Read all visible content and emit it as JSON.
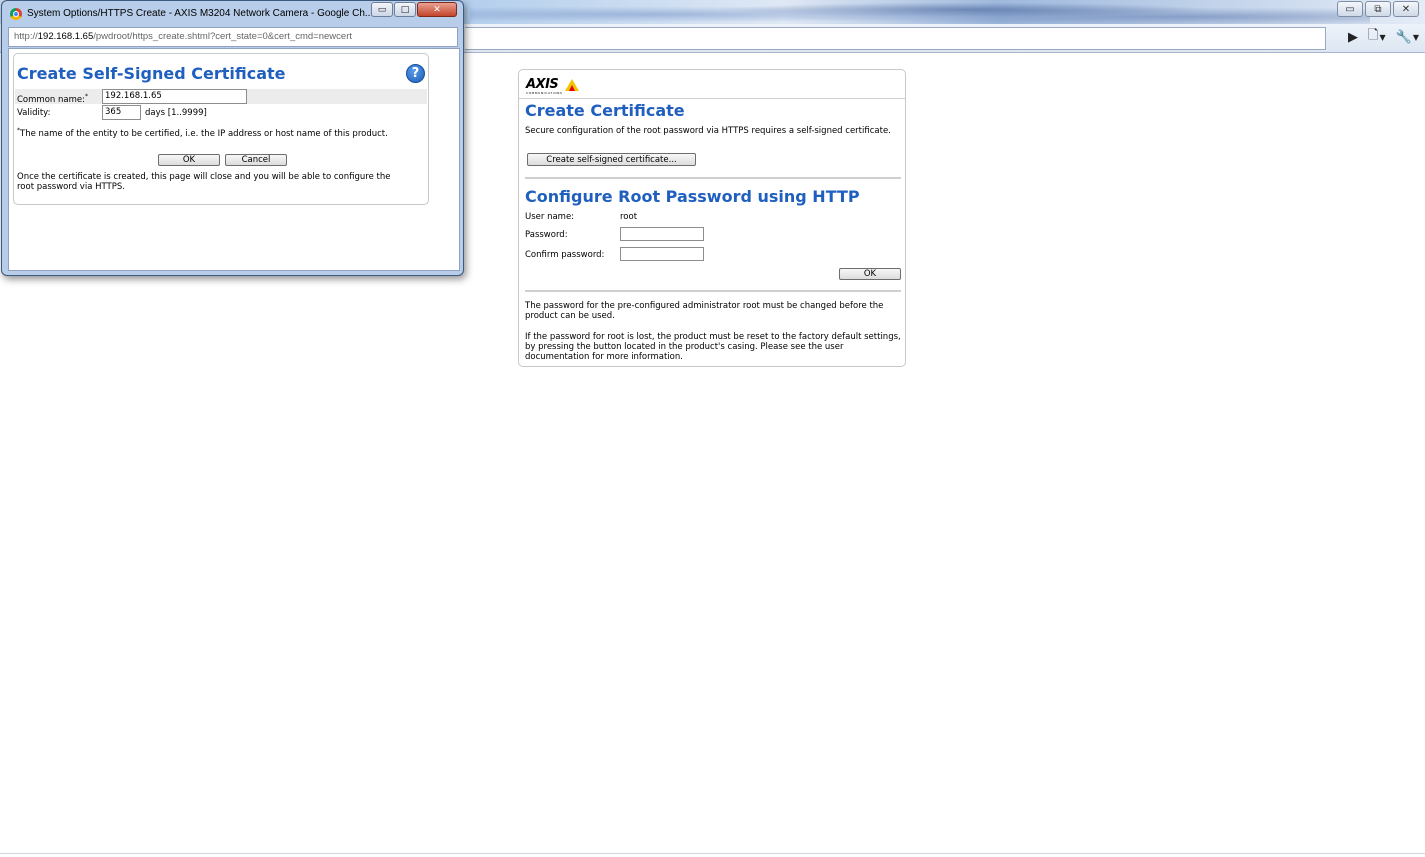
{
  "main_window": {
    "controls": {
      "minimize": "▭",
      "maximize": "⧉",
      "close": "✕"
    },
    "toolbar": {
      "play_icon": "play-icon",
      "page_icon": "page-icon",
      "wrench_icon": "wrench-icon"
    }
  },
  "axis_page": {
    "logo_text": "AXIS",
    "logo_sub": "COMMUNICATIONS",
    "create_certificate": {
      "title": "Create Certificate",
      "description": "Secure configuration of the root password via HTTPS requires a self-signed certificate.",
      "button_label": "Create self-signed certificate..."
    },
    "root_password": {
      "title": "Configure Root Password using HTTP",
      "user_name_label": "User name:",
      "user_name_value": "root",
      "password_label": "Password:",
      "confirm_label": "Confirm password:",
      "ok_label": "OK"
    },
    "notes": {
      "note1": "The password for the pre-configured administrator root must be changed before the product can be used.",
      "note2": "If the password for root is lost, the product must be reset to the factory default settings, by pressing the button located in the product's casing. Please see the user documentation for more information."
    }
  },
  "popup": {
    "window_title": "System Options/HTTPS Create - AXIS M3204 Network Camera - Google Ch...",
    "url_prefix": "http://",
    "url_host": "192.168.1.65",
    "url_path": "/pwdroot/https_create.shtml?cert_state=0&cert_cmd=newcert",
    "heading": "Create Self-Signed Certificate",
    "help_glyph": "?",
    "common_name_label": "Common name:",
    "required_mark": "*",
    "common_name_value": "192.168.1.65",
    "validity_label": "Validity:",
    "validity_value": "365",
    "days_hint": "days [1..9999]",
    "footnote": "The name of the entity to be certified, i.e. the IP address or host name of this product.",
    "ok_label": "OK",
    "cancel_label": "Cancel",
    "info": "Once the certificate is created, this page will close and you will be able to configure the root password via HTTPS."
  }
}
